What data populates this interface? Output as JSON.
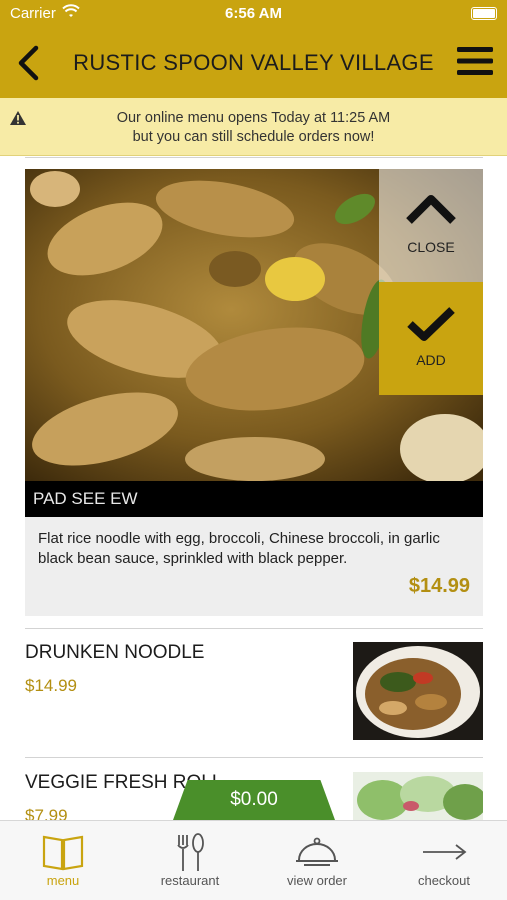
{
  "status_bar": {
    "carrier": "Carrier",
    "time": "6:56 AM"
  },
  "header": {
    "title": "RUSTIC SPOON VALLEY VILLAGE"
  },
  "notice": {
    "line1": "Our online menu opens Today at 11:25 AM",
    "line2": "but you can still schedule orders now!"
  },
  "featured_item": {
    "close_label": "CLOSE",
    "add_label": "ADD",
    "name": "PAD SEE EW",
    "description": "Flat rice noodle with egg, broccoli, Chinese broccoli, in garlic black bean sauce, sprinkled with black pepper.",
    "price": "$14.99"
  },
  "menu_items": [
    {
      "name": "DRUNKEN NOODLE",
      "price": "$14.99"
    },
    {
      "name": "VEGGIE FRESH ROLL",
      "price": "$7.99"
    }
  ],
  "cart": {
    "total": "$0.00"
  },
  "tabs": [
    {
      "label": "menu"
    },
    {
      "label": "restaurant"
    },
    {
      "label": "view order"
    },
    {
      "label": "checkout"
    }
  ],
  "colors": {
    "brand_gold": "#c9a410",
    "price_gold": "#b38f12",
    "cart_green": "#4a8f2a",
    "notice_bg": "#f7eba6"
  }
}
